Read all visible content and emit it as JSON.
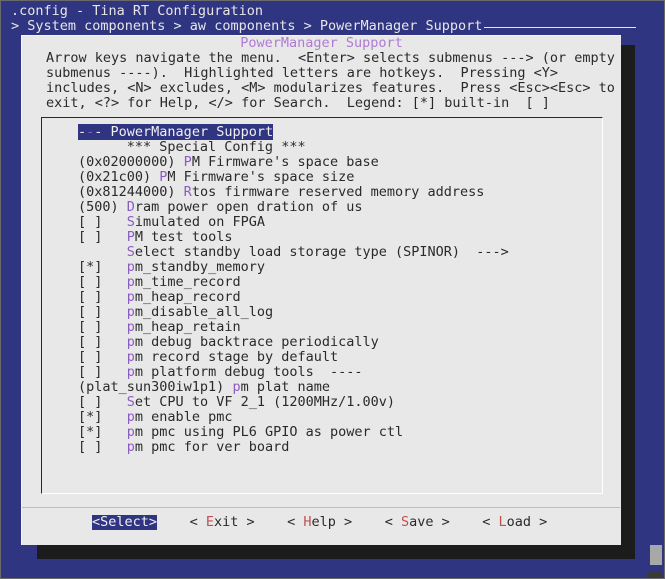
{
  "window": {
    "title": ".config - Tina RT Configuration",
    "breadcrumb": "> System components > aw components > PowerManager Support"
  },
  "dialog": {
    "title": "PowerManager Support",
    "help_lines": [
      "Arrow keys navigate the menu.  <Enter> selects submenus ---> (or empty",
      "submenus ----).  Highlighted letters are hotkeys.  Pressing <Y>",
      "includes, <N> excludes, <M> modularizes features.  Press <Esc><Esc> to",
      "exit, <?> for Help, </> for Search.  Legend: [*] built-in  [ ]"
    ]
  },
  "menu": {
    "items": [
      {
        "prefix": "",
        "hotkey": "-",
        "rest": "- PowerManager Support",
        "selected": true,
        "sel_lead": "-"
      },
      {
        "prefix": "      *** Special Config ***",
        "hotkey": "",
        "rest": ""
      },
      {
        "prefix": "(0x02000000) ",
        "hotkey": "P",
        "rest": "M Firmware's space base"
      },
      {
        "prefix": "(0x21c00) ",
        "hotkey": "P",
        "rest": "M Firmware's space size"
      },
      {
        "prefix": "(0x81244000) ",
        "hotkey": "R",
        "rest": "tos firmware reserved memory address"
      },
      {
        "prefix": "(500) ",
        "hotkey": "D",
        "rest": "ram power open dration of us"
      },
      {
        "prefix": "[ ]   ",
        "hotkey": "S",
        "rest": "imulated on FPGA"
      },
      {
        "prefix": "[ ]   ",
        "hotkey": "P",
        "rest": "M test tools"
      },
      {
        "prefix": "      ",
        "hotkey": "S",
        "rest": "elect standby load storage type (SPINOR)  --->"
      },
      {
        "prefix": "[*]   ",
        "hotkey": "p",
        "rest": "m_standby_memory"
      },
      {
        "prefix": "[ ]   ",
        "hotkey": "p",
        "rest": "m_time_record"
      },
      {
        "prefix": "[ ]   ",
        "hotkey": "p",
        "rest": "m_heap_record"
      },
      {
        "prefix": "[ ]   ",
        "hotkey": "p",
        "rest": "m_disable_all_log"
      },
      {
        "prefix": "[ ]   ",
        "hotkey": "p",
        "rest": "m_heap_retain"
      },
      {
        "prefix": "[ ]   ",
        "hotkey": "p",
        "rest": "m debug backtrace periodically"
      },
      {
        "prefix": "[ ]   ",
        "hotkey": "p",
        "rest": "m record stage by default"
      },
      {
        "prefix": "[ ]   ",
        "hotkey": "p",
        "rest": "m platform debug tools  ----"
      },
      {
        "prefix": "(plat_sun300iw1p1) ",
        "hotkey": "p",
        "rest": "m plat name"
      },
      {
        "prefix": "[ ]   ",
        "hotkey": "S",
        "rest": "et CPU to VF 2_1 (1200MHz/1.00v)"
      },
      {
        "prefix": "[*]   ",
        "hotkey": "p",
        "rest": "m enable pmc"
      },
      {
        "prefix": "[*]   ",
        "hotkey": "p",
        "rest": "m pmc using PL6 GPIO as power ctl"
      },
      {
        "prefix": "[ ]   ",
        "hotkey": "p",
        "rest": "m pmc for ver board"
      }
    ]
  },
  "buttons": {
    "select": {
      "open": "<",
      "hotkey": "S",
      "rest": "elect>"
    },
    "exit": {
      "open": "< ",
      "hotkey": "E",
      "rest": "xit >"
    },
    "help": {
      "open": "< ",
      "hotkey": "H",
      "rest": "elp >"
    },
    "save": {
      "open": "< ",
      "hotkey": "S",
      "rest": "ave >"
    },
    "load": {
      "open": "< ",
      "hotkey": "L",
      "rest": "oad >"
    }
  },
  "colors": {
    "terminal_bg": "#2f3580",
    "dialog_bg": "#e8e8e8",
    "hotkey": "#8c5cc4",
    "button_hotkey": "#c05050"
  }
}
